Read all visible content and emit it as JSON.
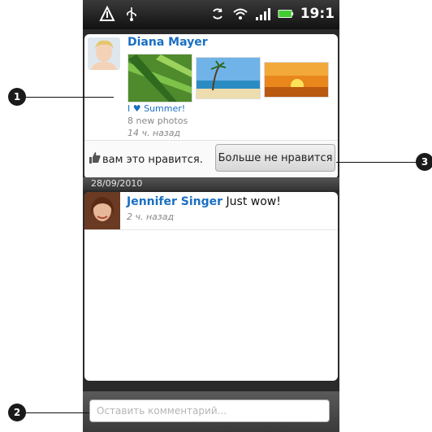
{
  "status_bar": {
    "time": "19:1",
    "icons": [
      "notification-icon",
      "usb-icon",
      "sync-icon",
      "wifi-icon",
      "signal-icon",
      "battery-icon"
    ]
  },
  "post1": {
    "author": "Diana Mayer",
    "album_title": "I ♥ Summer!",
    "photo_count": "8 new photos",
    "timestamp": "14 ч. назад",
    "like_text": "вам это нравится.",
    "unlike_button": "Больше не нравится"
  },
  "date_divider": "28/09/2010",
  "post2": {
    "author": "Jennifer Singer",
    "message": "Just wow!",
    "timestamp": "2 ч. назад"
  },
  "comment": {
    "placeholder": "Оставить комментарий..."
  },
  "callouts": [
    "1",
    "2",
    "3"
  ],
  "colors": {
    "accent": "#1a6fc2",
    "status_bar": "#111111",
    "battery": "#44cc33"
  }
}
